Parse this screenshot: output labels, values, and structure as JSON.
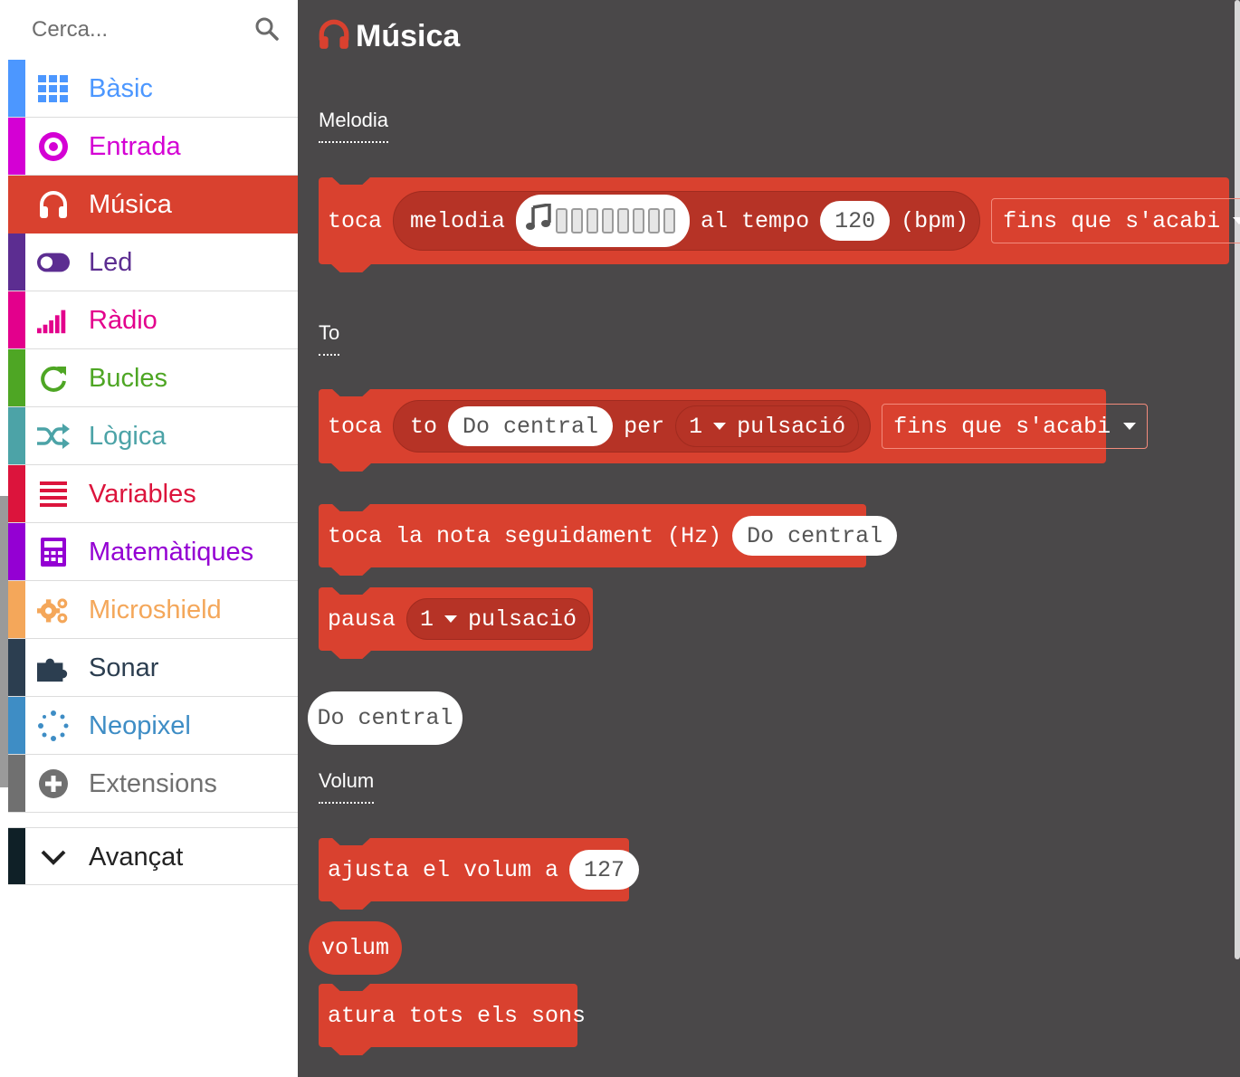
{
  "search": {
    "placeholder": "Cerca..."
  },
  "sidebar": {
    "items": [
      {
        "label": "Bàsic",
        "color": "#4c97ff",
        "icon": "grid-icon"
      },
      {
        "label": "Entrada",
        "color": "#d400d4",
        "icon": "target-icon"
      },
      {
        "label": "Música",
        "color": "#d9412f",
        "icon": "headphones-icon",
        "active": true
      },
      {
        "label": "Led",
        "color": "#5c2d91",
        "icon": "toggle-icon"
      },
      {
        "label": "Ràdio",
        "color": "#e3008c",
        "icon": "signal-bars-icon"
      },
      {
        "label": "Bucles",
        "color": "#4ea624",
        "icon": "refresh-icon"
      },
      {
        "label": "Lògica",
        "color": "#4ca3a7",
        "icon": "shuffle-icon"
      },
      {
        "label": "Variables",
        "color": "#dc143c",
        "icon": "lines-icon"
      },
      {
        "label": "Matemàtiques",
        "color": "#9400d3",
        "icon": "calculator-icon"
      },
      {
        "label": "Microshield",
        "color": "#f4a75a",
        "icon": "cogs-icon"
      },
      {
        "label": "Sonar",
        "color": "#2c3e50",
        "icon": "puzzle-icon"
      },
      {
        "label": "Neopixel",
        "color": "#3e8dc5",
        "icon": "dots-circle-icon"
      },
      {
        "label": "Extensions",
        "color": "#707070",
        "icon": "plus-circle-icon"
      }
    ],
    "advanced": {
      "label": "Avançat",
      "color": "#0f2027",
      "icon": "chevron-down-icon"
    }
  },
  "flyout": {
    "title": "Música",
    "sections": {
      "melodia": "Melodia",
      "to": "To",
      "volum": "Volum"
    },
    "blocks": {
      "play_melody": {
        "toca": "toca",
        "melodia": "melodia",
        "al_tempo": "al tempo",
        "tempo": "120",
        "bpm": "(bpm)",
        "mode": "fins que s'acabi"
      },
      "play_tone": {
        "toca": "toca",
        "to": "to",
        "note": "Do central",
        "per": "per",
        "beats": "1",
        "pulsacio": "pulsació",
        "mode": "fins que s'acabi"
      },
      "ring_tone": {
        "text": "toca la nota seguidament (Hz)",
        "note": "Do central"
      },
      "rest": {
        "pausa": "pausa",
        "beats": "1",
        "pulsacio": "pulsació"
      },
      "note_reporter": "Do central",
      "set_volume": {
        "text": "ajusta el volum a",
        "value": "127"
      },
      "volume_reporter": "volum",
      "stop_all": "atura tots els sons"
    }
  }
}
